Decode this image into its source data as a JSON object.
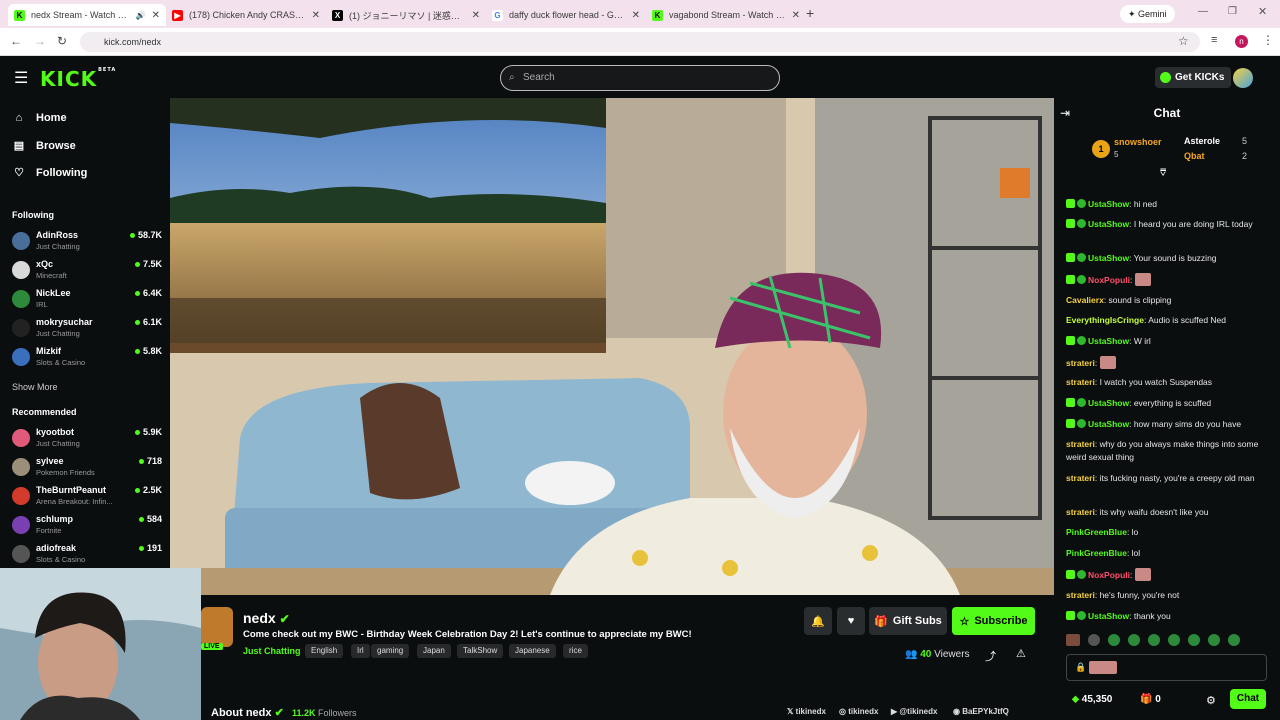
{
  "browser": {
    "tabs": [
      {
        "title": "nedx Stream - Watch Live o",
        "active": true,
        "favicon_color": "#53fc18",
        "favicon": "K"
      },
      {
        "title": "(178) Chicken Andy CRASHES N",
        "active": false,
        "favicon_color": "#ff0000",
        "favicon": "▶"
      },
      {
        "title": "(1) ジョニーリマソ | 迷惑外国人枠",
        "active": false,
        "favicon_color": "#000000",
        "favicon": "X"
      },
      {
        "title": "daffy duck flower head - Googl",
        "active": false,
        "favicon_color": "#4285f4",
        "favicon": "G"
      },
      {
        "title": "vagabond Stream - Watch Live",
        "active": false,
        "favicon_color": "#53fc18",
        "favicon": "K"
      }
    ],
    "new_tab": "+",
    "gemini_label": "Gemini",
    "url": "kick.com/nedx"
  },
  "header": {
    "logo": "KICK",
    "logo_badge": "BETA",
    "search_placeholder": "Search",
    "get_kicks": "Get KICKs"
  },
  "sidebar": {
    "nav": [
      {
        "label": "Home",
        "icon": "home-icon"
      },
      {
        "label": "Browse",
        "icon": "browse-icon"
      },
      {
        "label": "Following",
        "icon": "heart-icon"
      }
    ],
    "following_heading": "Following",
    "following": [
      {
        "name": "AdinRoss",
        "category": "Just Chatting",
        "viewers": "58.7K",
        "color": "#4a6e9a"
      },
      {
        "name": "xQc",
        "category": "Minecraft",
        "viewers": "7.5K",
        "color": "#d9d9d9"
      },
      {
        "name": "NickLee",
        "category": "IRL",
        "viewers": "6.4K",
        "color": "#2d8a3a"
      },
      {
        "name": "mokrysuchar",
        "category": "Just Chatting",
        "viewers": "6.1K",
        "color": "#222222"
      },
      {
        "name": "Mizkif",
        "category": "Slots & Casino",
        "viewers": "5.8K",
        "color": "#3a6fbd"
      }
    ],
    "show_more": "Show More",
    "recommended_heading": "Recommended",
    "recommended": [
      {
        "name": "kyootbot",
        "category": "Just Chatting",
        "viewers": "5.9K",
        "color": "#e05a7a"
      },
      {
        "name": "sylvee",
        "category": "Pokemon Friends",
        "viewers": "718",
        "color": "#9b8f7a"
      },
      {
        "name": "TheBurntPeanut",
        "category": "Arena Breakout: Infin...",
        "viewers": "2.5K",
        "color": "#d23a2a"
      },
      {
        "name": "schlump",
        "category": "Fortnite",
        "viewers": "584",
        "color": "#7a3fb0"
      },
      {
        "name": "adiofreak",
        "category": "Slots & Casino",
        "viewers": "191",
        "color": "#555555"
      }
    ]
  },
  "stream": {
    "name": "nedx",
    "live": "LIVE",
    "title": "Come check out my BWC - Birthday Week Celebration Day 2! Let's continue to appreciate my BWC!",
    "category": "Just Chatting",
    "tags": [
      "English",
      "Irl",
      "gaming",
      "Japan",
      "TalkShow",
      "Japanese",
      "rice"
    ],
    "gift_subs": "Gift Subs",
    "subscribe": "Subscribe",
    "viewers_count": "40",
    "viewers_label": "Viewers",
    "about": "About nedx",
    "followers_count": "11.2K",
    "followers_label": "Followers",
    "socials": [
      "tikinedx",
      "tikinedx",
      "@tikinedx",
      "BaEPYkJtfQ"
    ]
  },
  "chat": {
    "title": "Chat",
    "leaders": [
      {
        "name": "snowshoer",
        "count": "5",
        "rank": "1"
      },
      {
        "name": "Asterole",
        "count": "5"
      },
      {
        "name": "Qbat",
        "count": "2"
      }
    ],
    "messages": [
      {
        "user": "UstaShow",
        "text": "hi ned",
        "color": "#53fc18",
        "badges": true
      },
      {
        "user": "UstaShow",
        "text": "I heard you are doing IRL today",
        "color": "#53fc18",
        "badges": true
      },
      {
        "user": "UstaShow",
        "text": "Your sound is buzzing",
        "color": "#53fc18",
        "badges": true
      },
      {
        "user": "NoxPopuli",
        "text": "",
        "color": "#ff4d6d",
        "badges": true,
        "emote": true
      },
      {
        "user": "Cavalierx",
        "text": "sound is clipping",
        "color": "#f5d142",
        "badges": false
      },
      {
        "user": "EverythingIsCringe",
        "text": "Audio is scuffed Ned",
        "color": "#c6ff3d",
        "badges": false
      },
      {
        "user": "UstaShow",
        "text": "W irl",
        "color": "#53fc18",
        "badges": true
      },
      {
        "user": "strateri",
        "text": "",
        "color": "#f5d142",
        "badges": false,
        "emote": true
      },
      {
        "user": "strateri",
        "text": "I watch you watch Suspendas",
        "color": "#f5d142",
        "badges": false
      },
      {
        "user": "UstaShow",
        "text": "everything is scuffed",
        "color": "#53fc18",
        "badges": true
      },
      {
        "user": "UstaShow",
        "text": "how many sims do you have",
        "color": "#53fc18",
        "badges": true
      },
      {
        "user": "strateri",
        "text": "why do you always make things into some weird sexual thing",
        "color": "#f5d142",
        "badges": false
      },
      {
        "user": "strateri",
        "text": "its fucking nasty, you're a creepy old man",
        "color": "#f5d142",
        "badges": false
      },
      {
        "user": "strateri",
        "text": "its why waifu doesn't like you",
        "color": "#f5d142",
        "badges": false
      },
      {
        "user": "PinkGreenBlue",
        "text": "lo",
        "color": "#53fc18",
        "badges": false
      },
      {
        "user": "PinkGreenBlue",
        "text": "lol",
        "color": "#53fc18",
        "badges": false
      },
      {
        "user": "NoxPopuli",
        "text": "",
        "color": "#ff4d6d",
        "badges": true,
        "emote": true
      },
      {
        "user": "strateri",
        "text": "he's funny, you're not",
        "color": "#f5d142",
        "badges": false
      },
      {
        "user": "UstaShow",
        "text": "thank you",
        "color": "#53fc18",
        "badges": true
      }
    ],
    "points": "45,350",
    "gifts": "0",
    "send": "Chat"
  },
  "colors": {
    "accent": "#53fc18",
    "bg": "#0b0e0f"
  }
}
